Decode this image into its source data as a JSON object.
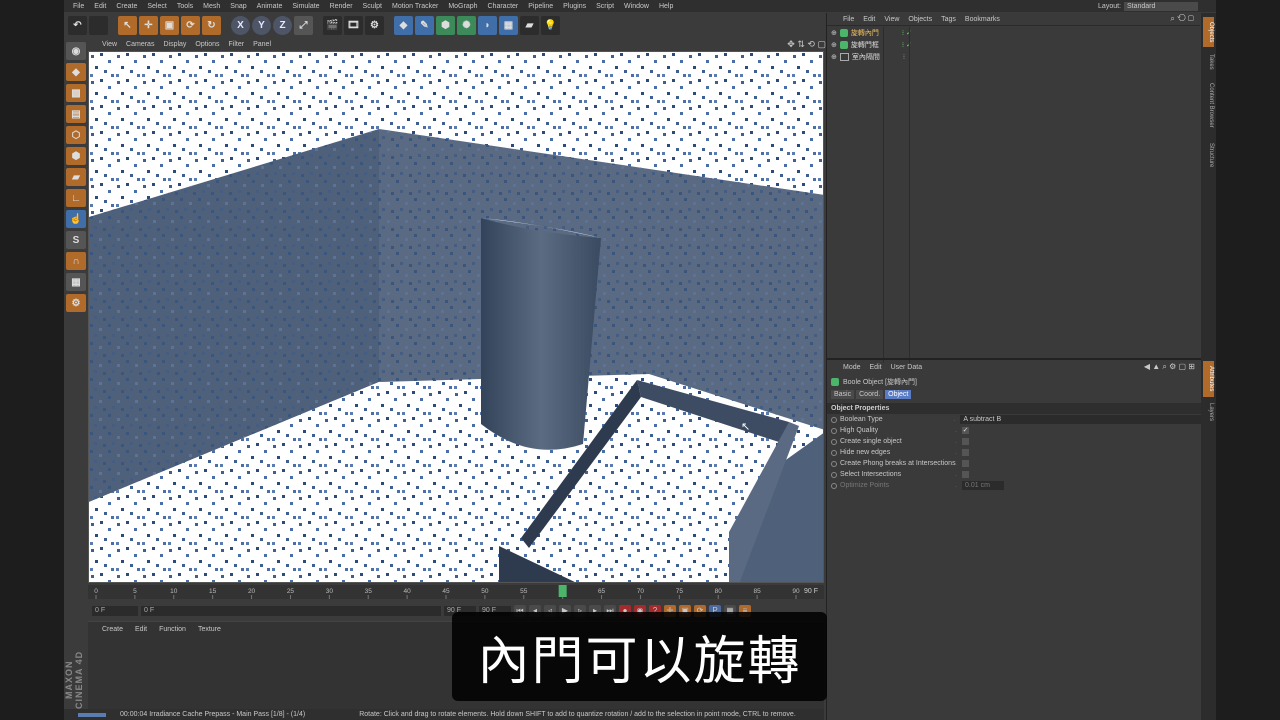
{
  "menubar": {
    "items": [
      "File",
      "Edit",
      "Create",
      "Select",
      "Tools",
      "Mesh",
      "Snap",
      "Animate",
      "Simulate",
      "Render",
      "Sculpt",
      "Motion Tracker",
      "MoGraph",
      "Character",
      "Pipeline",
      "Plugins",
      "Script",
      "Window",
      "Help"
    ],
    "layout_label": "Layout:",
    "layout_value": "Standard"
  },
  "toolbar": {
    "axis_x": "X",
    "axis_y": "Y",
    "axis_z": "Z"
  },
  "viewport": {
    "menu": [
      "View",
      "Cameras",
      "Display",
      "Options",
      "Filter",
      "Panel"
    ]
  },
  "timeline": {
    "ticks": [
      "0",
      "5",
      "10",
      "15",
      "20",
      "25",
      "30",
      "35",
      "40",
      "45",
      "50",
      "55",
      "60",
      "65",
      "70",
      "75",
      "80",
      "85",
      "90"
    ],
    "end_label": "90 F",
    "current_frame": 60,
    "max_frame": 90
  },
  "playbar": {
    "start_field": "0 F",
    "min_field": "0 F",
    "end_field": "90 F",
    "max_field": "90 F"
  },
  "material_manager": {
    "menu": [
      "Create",
      "Edit",
      "Function",
      "Texture"
    ]
  },
  "logo": {
    "text": "MAXON CINEMA 4D"
  },
  "status": {
    "time": "00:00:04 Irradiance Cache Prepass - Main Pass [1/8] - (1/4)",
    "hint": "Rotate: Click and drag to rotate elements. Hold down SHIFT to add to quantize rotation / add to the selection in point mode, CTRL to remove.",
    "progress": 0.4
  },
  "object_manager": {
    "menu": [
      "File",
      "Edit",
      "View",
      "Objects",
      "Tags",
      "Bookmarks"
    ],
    "objects": [
      {
        "name": "旋轉內門",
        "type": "boole"
      },
      {
        "name": "旋轉門框",
        "type": "boole"
      },
      {
        "name": "室內隔間",
        "type": "null"
      }
    ]
  },
  "attributes": {
    "menu": [
      "Mode",
      "Edit",
      "User Data"
    ],
    "title": "Boole Object [旋轉內門]",
    "tabs": [
      "Basic",
      "Coord.",
      "Object"
    ],
    "active_tab": "Object",
    "section": "Object Properties",
    "props": [
      {
        "label": "Boolean Type",
        "value": "A subtract B",
        "kind": "select"
      },
      {
        "label": "High Quality",
        "value": "✓",
        "kind": "check"
      },
      {
        "label": "Create single object",
        "value": "",
        "kind": "check"
      },
      {
        "label": "Hide new edges",
        "value": "",
        "kind": "check"
      },
      {
        "label": "Create Phong breaks at Intersections",
        "value": "",
        "kind": "check"
      },
      {
        "label": "Select Intersections",
        "value": "",
        "kind": "check"
      },
      {
        "label": "Optimize Points",
        "value": "0.01 cm",
        "kind": "num"
      }
    ]
  },
  "side_tabs": {
    "top": [
      "Objects",
      "Takes",
      "Content Browser",
      "Structure"
    ],
    "bottom": [
      "Attributes",
      "Layers"
    ]
  },
  "caption": {
    "text": "內門可以旋轉"
  },
  "colors": {
    "accent": "#b06a2a",
    "selection": "#5a7cc4",
    "wall": "#4d5f78"
  }
}
